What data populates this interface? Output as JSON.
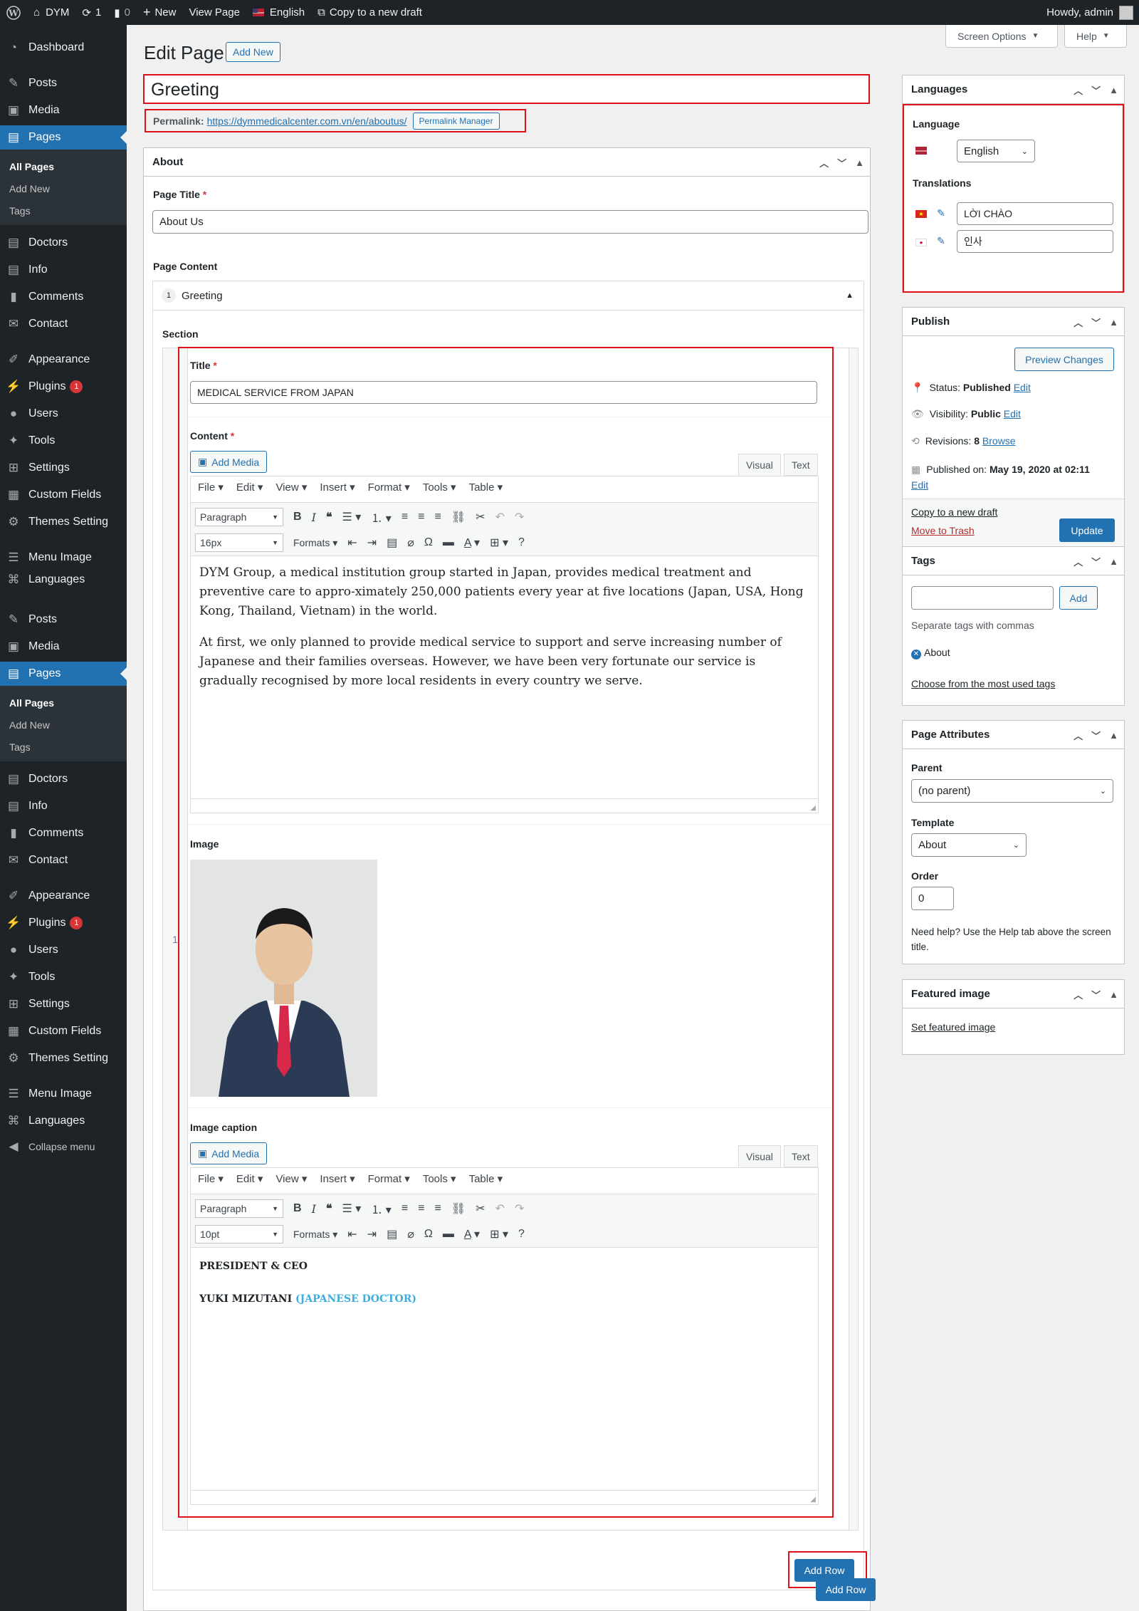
{
  "admin_bar": {
    "site_name": "DYM",
    "updates_count": "1",
    "comments_count": "0",
    "new_label": "New",
    "view_page": "View Page",
    "language": "English",
    "copy_draft": "Copy to a new draft",
    "howdy": "Howdy, admin"
  },
  "sidebar": {
    "dashboard": "Dashboard",
    "posts": "Posts",
    "media": "Media",
    "pages": "Pages",
    "all_pages": "All Pages",
    "add_new": "Add New",
    "tags": "Tags",
    "doctors": "Doctors",
    "info": "Info",
    "comments": "Comments",
    "contact": "Contact",
    "appearance": "Appearance",
    "plugins": "Plugins",
    "plugins_badge": "1",
    "users": "Users",
    "tools": "Tools",
    "settings": "Settings",
    "custom_fields": "Custom Fields",
    "themes_setting": "Themes Setting",
    "menu_image": "Menu Image",
    "languages": "Languages",
    "collapse": "Collapse menu"
  },
  "header": {
    "title": "Edit Page",
    "add_new": "Add New",
    "screen_options": "Screen Options",
    "help": "Help"
  },
  "post": {
    "title": "Greeting",
    "permalink_label": "Permalink:",
    "permalink_url": "https://dymmedicalcenter.com.vn/en/aboutus/",
    "permalink_manager": "Permalink Manager"
  },
  "about_box": {
    "heading": "About",
    "page_title_label": "Page Title",
    "page_title_value": "About Us",
    "page_content_label": "Page Content",
    "layout_index": "1",
    "layout_name": "Greeting",
    "section_label": "Section",
    "row_number": "1",
    "title_label": "Title",
    "title_value": "MEDICAL SERVICE FROM JAPAN",
    "content_label": "Content",
    "image_label": "Image",
    "caption_label": "Image caption",
    "add_row": "Add Row",
    "add_row_outer": "Add Row"
  },
  "editor": {
    "add_media": "Add Media",
    "visual": "Visual",
    "text": "Text",
    "menus": [
      "File",
      "Edit",
      "View",
      "Insert",
      "Format",
      "Tools",
      "Table"
    ],
    "paragraph": "Paragraph",
    "formats": "Formats",
    "font_size_content": "16px",
    "font_size_caption": "10pt"
  },
  "content_text": {
    "p1": "DYM Group, a medical institution group started in Japan, provides medical treatment and preventive care to appro-ximately 250,000 patients every year at five locations (Japan, USA, Hong Kong, Thailand, Vietnam) in the world.",
    "p2": "At first, we only planned to provide medical service to support and serve increasing number of Japanese and their families overseas. However, we have been very fortunate our service is gradually recognised by more local residents in every country we serve."
  },
  "caption_text": {
    "line1": "PRESIDENT & CEO",
    "line2_name": "YUKI MIZUTANI",
    "line2_role": "(JAPANESE DOCTOR)",
    "role_color": "#3aaee0"
  },
  "languages_box": {
    "heading": "Languages",
    "language_label": "Language",
    "language_value": "English",
    "translations_label": "Translations",
    "vi_value": "LỜI CHÀO",
    "ko_value": "인사"
  },
  "publish_box": {
    "heading": "Publish",
    "preview": "Preview Changes",
    "status_label": "Status:",
    "status_value": "Published",
    "visibility_label": "Visibility:",
    "visibility_value": "Public",
    "revisions_label": "Revisions:",
    "revisions_value": "8",
    "browse": "Browse",
    "published_label": "Published on:",
    "published_value": "May 19, 2020 at 02:11",
    "edit": "Edit",
    "copy_draft": "Copy to a new draft",
    "trash": "Move to Trash",
    "update": "Update"
  },
  "tags_box": {
    "heading": "Tags",
    "add": "Add",
    "hint": "Separate tags with commas",
    "tag": "About",
    "choose": "Choose from the most used tags"
  },
  "attributes_box": {
    "heading": "Page Attributes",
    "parent_label": "Parent",
    "parent_value": "(no parent)",
    "template_label": "Template",
    "template_value": "About",
    "order_label": "Order",
    "order_value": "0",
    "help_text": "Need help? Use the Help tab above the screen title."
  },
  "featured_box": {
    "heading": "Featured image",
    "set": "Set featured image"
  },
  "colors": {
    "accent": "#2271b1",
    "highlight_border": "#e0101a",
    "admin_dark": "#1d2327"
  }
}
